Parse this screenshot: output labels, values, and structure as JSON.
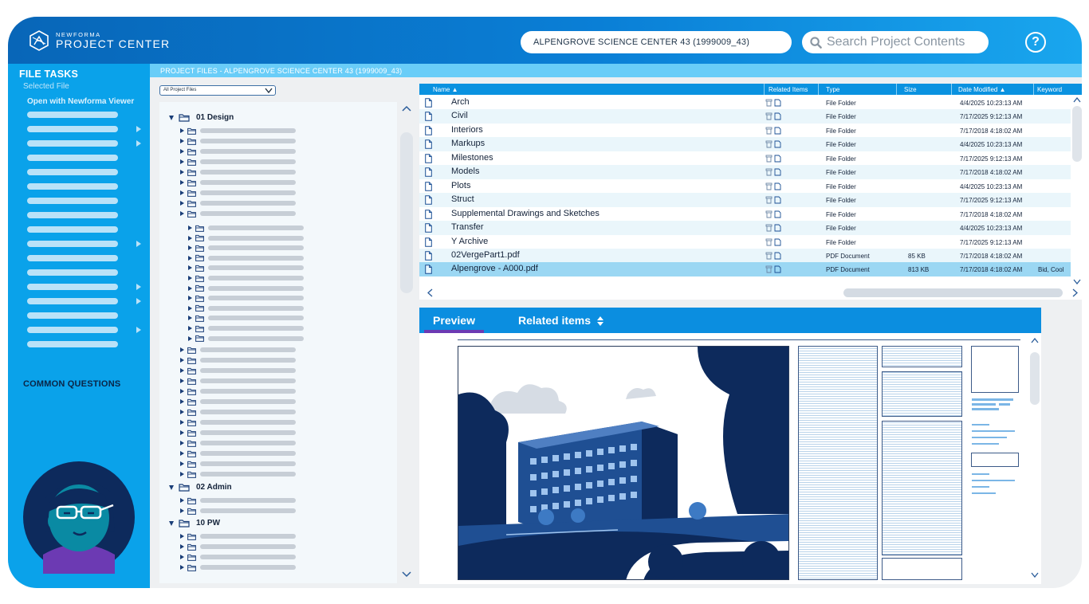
{
  "header": {
    "logo_top": "NEWFORMA",
    "logo_main": "PROJECT CENTER",
    "project_selector": "ALPENGROVE SCIENCE CENTER 43 (1999009_43)",
    "search_placeholder": "Search Project Contents",
    "help_label": "?"
  },
  "sidebar": {
    "file_tasks_title": "FILE TASKS",
    "selected_file": "Selected File",
    "open_viewer": "Open with Newforma Viewer",
    "common_questions": "COMMON QUESTIONS"
  },
  "breadcrumb": "PROJECT FILES - ALPENGROVE SCIENCE CENTER 43 (1999009_43)",
  "tree": {
    "filter_value": "All Project Files",
    "groups": [
      "01 Design",
      "02 Admin",
      "10 PW"
    ]
  },
  "file_list": {
    "columns": [
      "Name ▲",
      "Related Items",
      "Type",
      "Size",
      "Date Modified ▲",
      "Keyword"
    ],
    "rows": [
      {
        "name": "Arch",
        "type": "File Folder",
        "size": "",
        "date": "4/4/2025 10:23:13 AM",
        "keyword": ""
      },
      {
        "name": "Civil",
        "type": "File Folder",
        "size": "",
        "date": "7/17/2025 9:12:13 AM",
        "keyword": ""
      },
      {
        "name": "Interiors",
        "type": "File Folder",
        "size": "",
        "date": "7/17/2018 4:18:02 AM",
        "keyword": ""
      },
      {
        "name": "Markups",
        "type": "File Folder",
        "size": "",
        "date": "4/4/2025 10:23:13 AM",
        "keyword": ""
      },
      {
        "name": "Milestones",
        "type": "File Folder",
        "size": "",
        "date": "7/17/2025 9:12:13 AM",
        "keyword": ""
      },
      {
        "name": "Models",
        "type": "File Folder",
        "size": "",
        "date": "7/17/2018 4:18:02 AM",
        "keyword": ""
      },
      {
        "name": "Plots",
        "type": "File Folder",
        "size": "",
        "date": "4/4/2025 10:23:13 AM",
        "keyword": ""
      },
      {
        "name": "Struct",
        "type": "File Folder",
        "size": "",
        "date": "7/17/2025 9:12:13 AM",
        "keyword": ""
      },
      {
        "name": "Supplemental Drawings and Sketches",
        "type": "File Folder",
        "size": "",
        "date": "7/17/2018 4:18:02 AM",
        "keyword": ""
      },
      {
        "name": "Transfer",
        "type": "File Folder",
        "size": "",
        "date": "4/4/2025 10:23:13 AM",
        "keyword": ""
      },
      {
        "name": "Y Archive",
        "type": "File Folder",
        "size": "",
        "date": "7/17/2025 9:12:13 AM",
        "keyword": ""
      },
      {
        "name": "02VergePart1.pdf",
        "type": "PDF Document",
        "size": "85 KB",
        "date": "7/17/2018 4:18:02 AM",
        "keyword": ""
      },
      {
        "name": "Alpengrove - A000.pdf",
        "type": "PDF Document",
        "size": "813 KB",
        "date": "7/17/2018 4:18:02 AM",
        "keyword": "Bid, Cool"
      }
    ]
  },
  "preview": {
    "tab_preview": "Preview",
    "tab_related": "Related items"
  },
  "colors": {
    "header_blue": "#0866b8",
    "sidebar_blue": "#0aa2ea",
    "accent_purple": "#6c3ab3",
    "navy": "#0d2a5c"
  }
}
